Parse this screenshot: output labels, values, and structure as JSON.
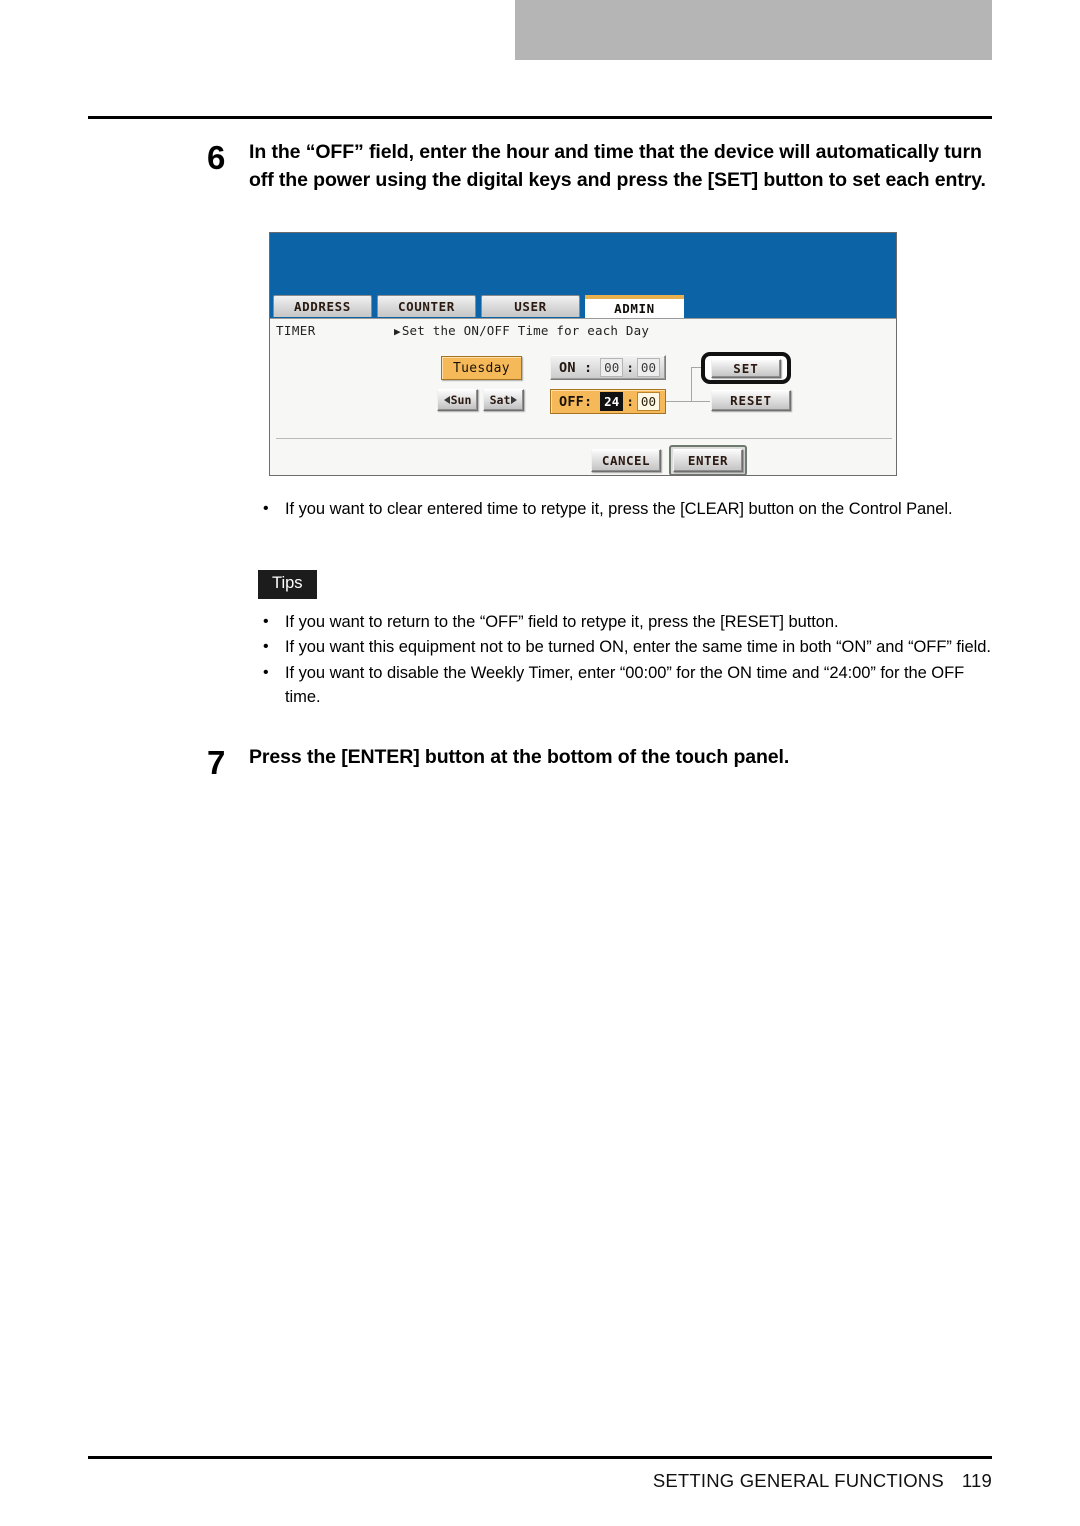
{
  "page": {
    "footer_title": "SETTING GENERAL FUNCTIONS",
    "page_number": "119",
    "tab_marker_color": "#b5b5b5"
  },
  "steps": [
    {
      "number": "6",
      "text": "In the “OFF” field, enter the hour and time that the device will automatically turn off the power using the digital keys and press the [SET] button to set each entry."
    },
    {
      "number": "7",
      "text": "Press the [ENTER] button at the bottom of the touch panel."
    }
  ],
  "clear_note": {
    "bullet": "•",
    "text": "If you want to clear entered time to retype it, press the [CLEAR] button on the Control Panel."
  },
  "tips": {
    "badge_label": "Tips",
    "bullet": "•",
    "items": [
      "If you want to return to the “OFF” field to retype it, press the [RESET] button.",
      "If you want this equipment not to be turned ON, enter the same time in both “ON” and “OFF” field.",
      "If you want to disable the Weekly Timer, enter “00:00” for the ON time and “24:00” for the OFF time."
    ]
  },
  "touch_panel": {
    "header_color": "#0c63a6",
    "accent_color": "#e8b04e",
    "highlight_color": "#f5b95a",
    "tabs": [
      {
        "label": "ADDRESS",
        "active": false
      },
      {
        "label": "COUNTER",
        "active": false
      },
      {
        "label": "USER",
        "active": false
      },
      {
        "label": "ADMIN",
        "active": true
      }
    ],
    "screen": {
      "section_label": "TIMER",
      "caret_icon": "▶",
      "instruction": "Set the ON/OFF Time for each Day"
    },
    "day_selector": {
      "current_day": "Tuesday",
      "prev_label": "Sun",
      "next_label": "Sat"
    },
    "time_fields": [
      {
        "label": "ON :",
        "hour": "00",
        "minute": "00",
        "separator": ":",
        "selected_part": "none",
        "state": "normal"
      },
      {
        "label": "OFF:",
        "hour": "24",
        "minute": "00",
        "separator": ":",
        "selected_part": "hour",
        "state": "highlighted"
      }
    ],
    "side_buttons": {
      "set_label": "SET",
      "set_highlighted": true,
      "reset_label": "RESET"
    },
    "action_buttons": {
      "cancel_label": "CANCEL",
      "enter_label": "ENTER",
      "enter_focused": true
    }
  }
}
